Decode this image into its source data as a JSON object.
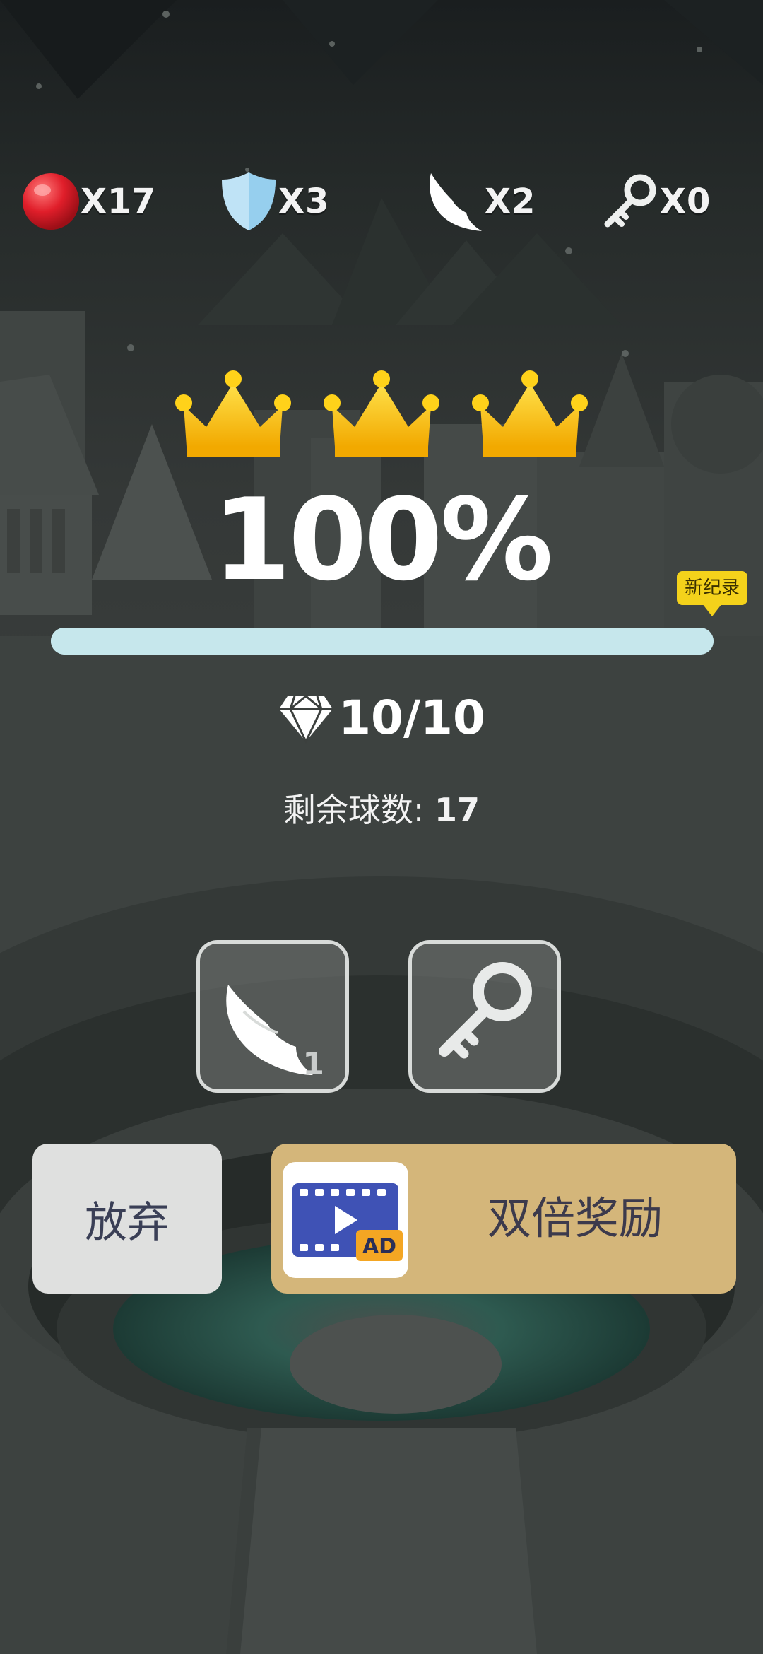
{
  "hud": {
    "balls": "X17",
    "shields": "X3",
    "wings": "X2",
    "keys": "X0"
  },
  "result": {
    "crowns_earned": 3,
    "crowns_total": 3,
    "percent": "100%",
    "progress_fraction": 1.0,
    "new_record_badge": "新纪录",
    "gems": "10/10",
    "balls_left_label": "剩余球数:",
    "balls_left_value": "17"
  },
  "powerups": [
    {
      "name": "wing",
      "count": "1"
    },
    {
      "name": "key",
      "count": ""
    }
  ],
  "buttons": {
    "give_up": "放弃",
    "double_reward": "双倍奖励",
    "ad_tag": "AD"
  },
  "colors": {
    "crown": "#f9c80e",
    "progress": "#b6dfe5",
    "double_button": "#d4b67a",
    "badge": "#f4d21b"
  }
}
